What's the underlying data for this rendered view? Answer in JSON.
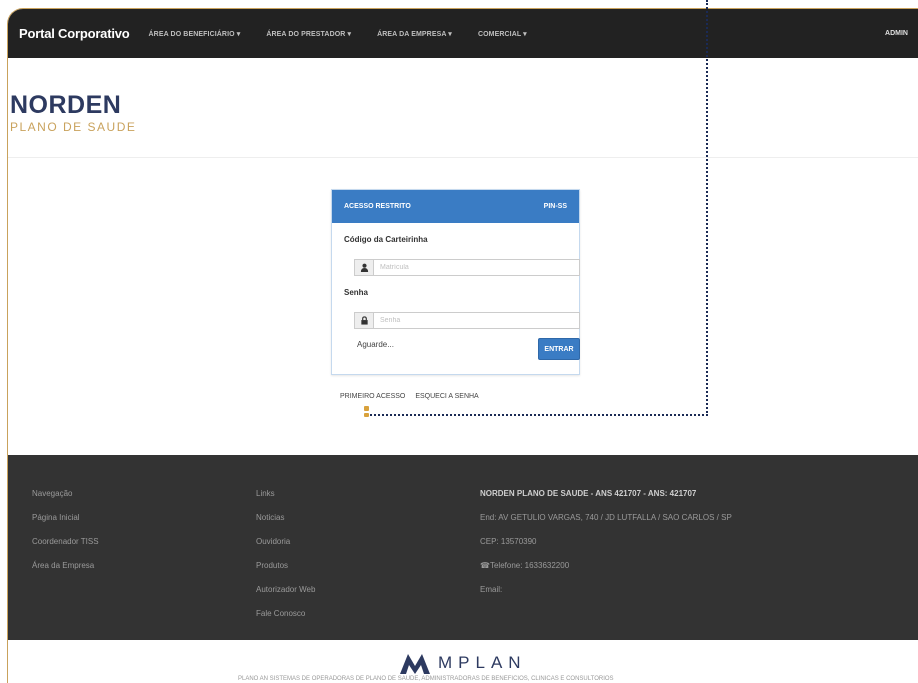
{
  "navbar": {
    "brand": "Portal Corporativo",
    "items": [
      "ÁREA DO BENEFICIÁRIO ▾",
      "ÁREA DO PRESTADOR ▾",
      "ÁREA DA EMPRESA ▾",
      "COMERCIAL ▾"
    ],
    "admin": "ADMIN"
  },
  "logo": {
    "main": "NORDEN",
    "sub": "PLANO DE SAUDE"
  },
  "login": {
    "title": "ACESSO RESTRITO",
    "code": "PIN-SS",
    "card_label": "Código da Carteirinha",
    "card_placeholder": "Matrícula",
    "password_label": "Senha",
    "password_placeholder": "Senha",
    "status": "Aguarde...",
    "submit": "ENTRAR"
  },
  "links": {
    "first_access": "PRIMEIRO ACESSO",
    "forgot": "ESQUECI A SENHA"
  },
  "footer": {
    "col1": [
      "Navegação",
      "Página Inicial",
      "Coordenador TISS",
      "Área da Empresa"
    ],
    "col2": [
      "Links",
      "Noticias",
      "Ouvidoria",
      "Produtos",
      "Autorizador Web",
      "Fale Conosco"
    ],
    "col3_title": "NORDEN PLANO DE SAUDE - ANS 421707 - ANS: 421707",
    "col3": [
      "End: AV GETULIO VARGAS, 740 / JD LUTFALLA / SAO CARLOS / SP",
      "CEP: 13570390",
      "☎Telefone: 1633632200",
      "Email:"
    ]
  },
  "bottom": {
    "brand": "MPLAN",
    "tagline": "PLANO AN SISTEMAS DE OPERADORAS DE PLANO DE SAUDE, ADMINISTRADORAS DE BENEFICIOS, CLINICAS E CONSULTORIOS"
  },
  "colors": {
    "navbar": "#222222",
    "primary": "#3a7cc4",
    "footer": "#333333",
    "logo": "#2d3a60",
    "accent": "#c9a25c"
  }
}
